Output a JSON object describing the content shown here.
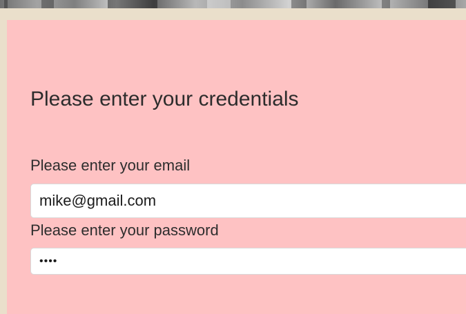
{
  "form": {
    "title": "Please enter your credentials",
    "email_label": "Please enter your email",
    "email_value": "mike@gmail.com",
    "password_label": "Please enter your password",
    "password_value": "••••"
  },
  "colors": {
    "panel_background": "#fec2c3",
    "page_background": "#eadfcb",
    "field_background": "#ffffff",
    "text": "#2c2c2c"
  }
}
